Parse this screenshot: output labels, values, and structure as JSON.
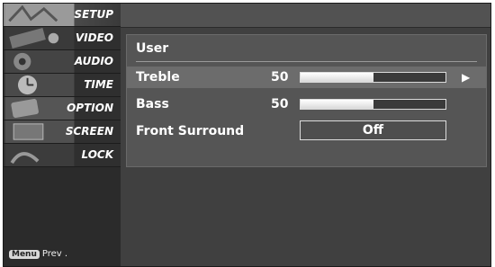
{
  "sidebar": {
    "items": [
      {
        "label": "SETUP",
        "icon": "setup-icon"
      },
      {
        "label": "VIDEO",
        "icon": "video-icon"
      },
      {
        "label": "AUDIO",
        "icon": "audio-icon"
      },
      {
        "label": "TIME",
        "icon": "time-icon"
      },
      {
        "label": "OPTION",
        "icon": "option-icon"
      },
      {
        "label": "SCREEN",
        "icon": "screen-icon"
      },
      {
        "label": "LOCK",
        "icon": "lock-icon"
      }
    ],
    "footer": {
      "badge": "Menu",
      "text": "Prev ."
    }
  },
  "panel": {
    "title": "User",
    "rows": [
      {
        "label": "Treble",
        "value": "50",
        "level_percent": 50,
        "selected": true
      },
      {
        "label": "Bass",
        "value": "50",
        "level_percent": 50,
        "selected": false
      },
      {
        "label": "Front Surround",
        "value": "Off",
        "selected": false
      }
    ],
    "selected_arrow": "▶"
  },
  "colors": {
    "osd_background": "#3c3c3c",
    "selected_row": "#6c6c6c",
    "text": "#ffffff"
  }
}
